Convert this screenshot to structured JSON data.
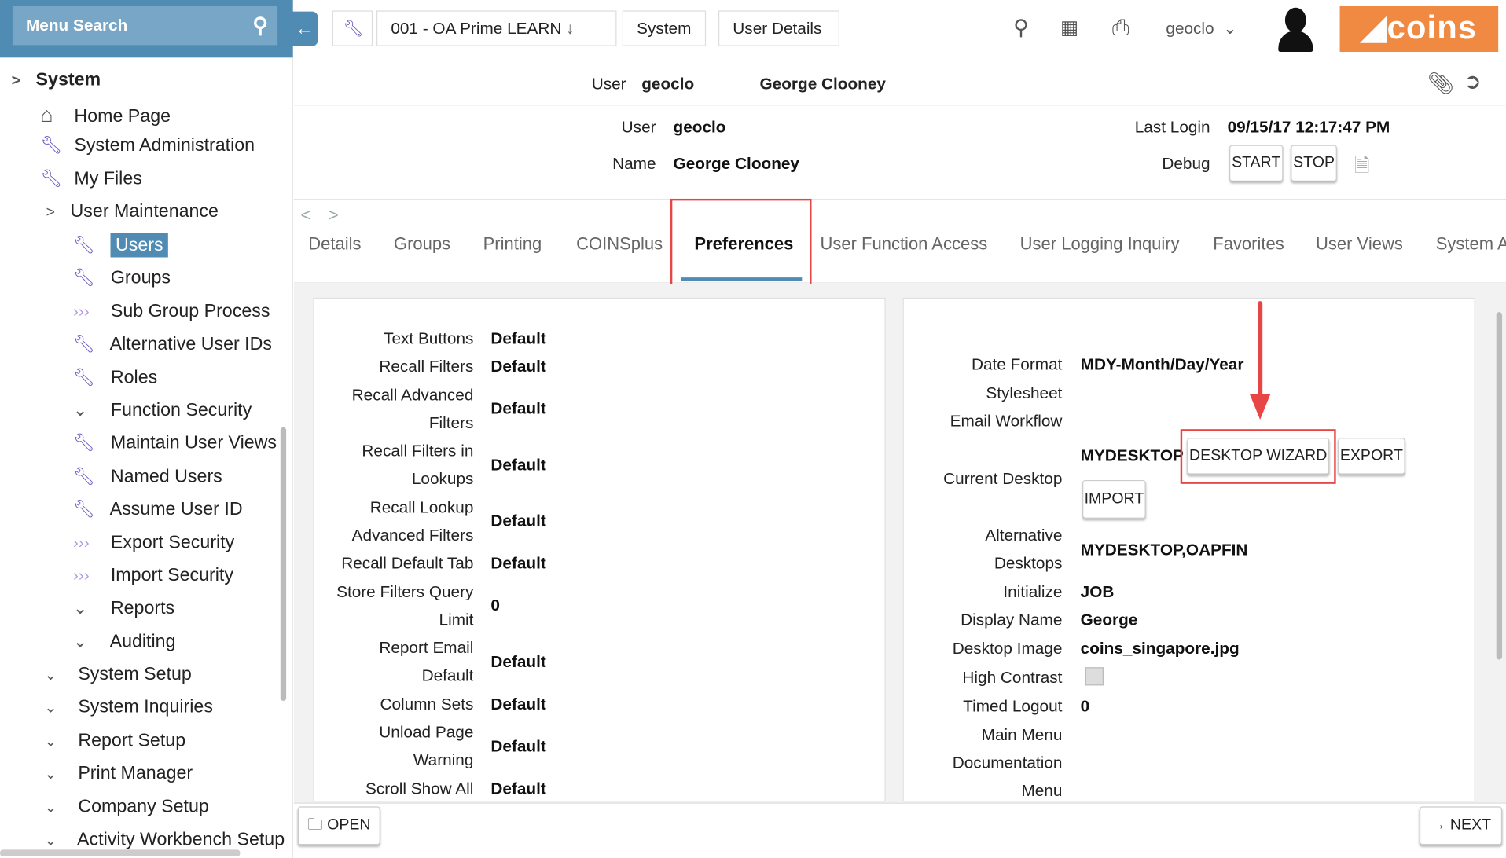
{
  "menu_search": {
    "placeholder": "Menu Search"
  },
  "breadcrumb": [
    "001 - OA Prime LEARN",
    "System",
    "User Details"
  ],
  "header": {
    "username": "geoclo"
  },
  "logo": "coins",
  "record_bar": {
    "user_label": "User",
    "user": "geoclo",
    "name": "George Clooney"
  },
  "summary": {
    "user_label": "User",
    "user": "geoclo",
    "name_label": "Name",
    "name": "George Clooney",
    "last_login_label": "Last Login",
    "last_login": "09/15/17 12:17:47 PM",
    "debug_label": "Debug",
    "start": "START",
    "stop": "STOP"
  },
  "tabs": [
    "Details",
    "Groups",
    "Printing",
    "COINSplus",
    "Preferences",
    "User Function Access",
    "User Logging Inquiry",
    "Favorites",
    "User Views",
    "System A"
  ],
  "active_tab": "Preferences",
  "sidebar": {
    "root": "System",
    "items": [
      {
        "label": "Home Page",
        "icon": "home-icon"
      },
      {
        "label": "System Administration",
        "icon": "wrench-icon"
      },
      {
        "label": "My Files",
        "icon": "wrench-icon"
      },
      {
        "label": "User Maintenance",
        "icon": "chevron-right-icon"
      }
    ],
    "sub_items": [
      {
        "label": "Users",
        "icon": "wrench-icon",
        "selected": true
      },
      {
        "label": "Groups",
        "icon": "wrench-icon"
      },
      {
        "label": "Sub Group Process",
        "icon": "process-icon"
      },
      {
        "label": "Alternative User IDs",
        "icon": "wrench-icon"
      },
      {
        "label": "Roles",
        "icon": "wrench-icon"
      },
      {
        "label": "Function Security",
        "icon": "chevron-down-icon"
      },
      {
        "label": "Maintain User Views",
        "icon": "wrench-icon"
      },
      {
        "label": "Named Users",
        "icon": "wrench-icon"
      },
      {
        "label": "Assume User ID",
        "icon": "wrench-icon"
      },
      {
        "label": "Export Security",
        "icon": "process-icon"
      },
      {
        "label": "Import Security",
        "icon": "process-icon"
      },
      {
        "label": "Reports",
        "icon": "chevron-down-icon"
      },
      {
        "label": "Auditing",
        "icon": "chevron-down-icon"
      }
    ],
    "groups": [
      "System Setup",
      "System Inquiries",
      "Report Setup",
      "Print Manager",
      "Company Setup",
      "Activity Workbench Setup"
    ]
  },
  "left_prefs": [
    {
      "label": [
        "Text Buttons"
      ],
      "value": "Default"
    },
    {
      "label": [
        "Recall Filters"
      ],
      "value": "Default"
    },
    {
      "label": [
        "Recall Advanced",
        "Filters"
      ],
      "value": "Default"
    },
    {
      "label": [
        "Recall Filters in",
        "Lookups"
      ],
      "value": "Default"
    },
    {
      "label": [
        "Recall Lookup",
        "Advanced Filters"
      ],
      "value": "Default"
    },
    {
      "label": [
        "Recall Default Tab"
      ],
      "value": "Default"
    },
    {
      "label": [
        "Store Filters Query",
        "Limit"
      ],
      "value": "0"
    },
    {
      "label": [
        "Report Email",
        "Default"
      ],
      "value": "Default"
    },
    {
      "label": [
        "Column Sets"
      ],
      "value": "Default"
    },
    {
      "label": [
        "Unload Page",
        "Warning"
      ],
      "value": "Default"
    },
    {
      "label": [
        "Scroll Show All"
      ],
      "value": "Default"
    }
  ],
  "right_prefs": {
    "date_format_label": "Date Format",
    "date_format": "MDY-Month/Day/Year",
    "stylesheet_label": "Stylesheet",
    "email_workflow_label": "Email Workflow",
    "current_desktop_label": "Current Desktop",
    "current_desktop": "MYDESKTOP",
    "desktop_wizard": "DESKTOP WIZARD",
    "export": "EXPORT",
    "import": "IMPORT",
    "alt_desktops_label": [
      "Alternative",
      "Desktops"
    ],
    "alt_desktops": "MYDESKTOP,OAPFIN",
    "initialize_label": "Initialize",
    "initialize": "JOB",
    "display_name_label": "Display Name",
    "display_name": "George",
    "desktop_image_label": "Desktop Image",
    "desktop_image": "coins_singapore.jpg",
    "high_contrast_label": "High Contrast",
    "high_contrast": false,
    "timed_logout_label": "Timed Logout",
    "timed_logout": "0",
    "main_menu_label": [
      "Main Menu",
      "Documentation",
      "Menu"
    ]
  },
  "footer": {
    "open": "OPEN",
    "next": "NEXT"
  },
  "colors": {
    "accent": "#4f8bb3",
    "brand": "#f08a42",
    "highlight": "#e84545"
  }
}
